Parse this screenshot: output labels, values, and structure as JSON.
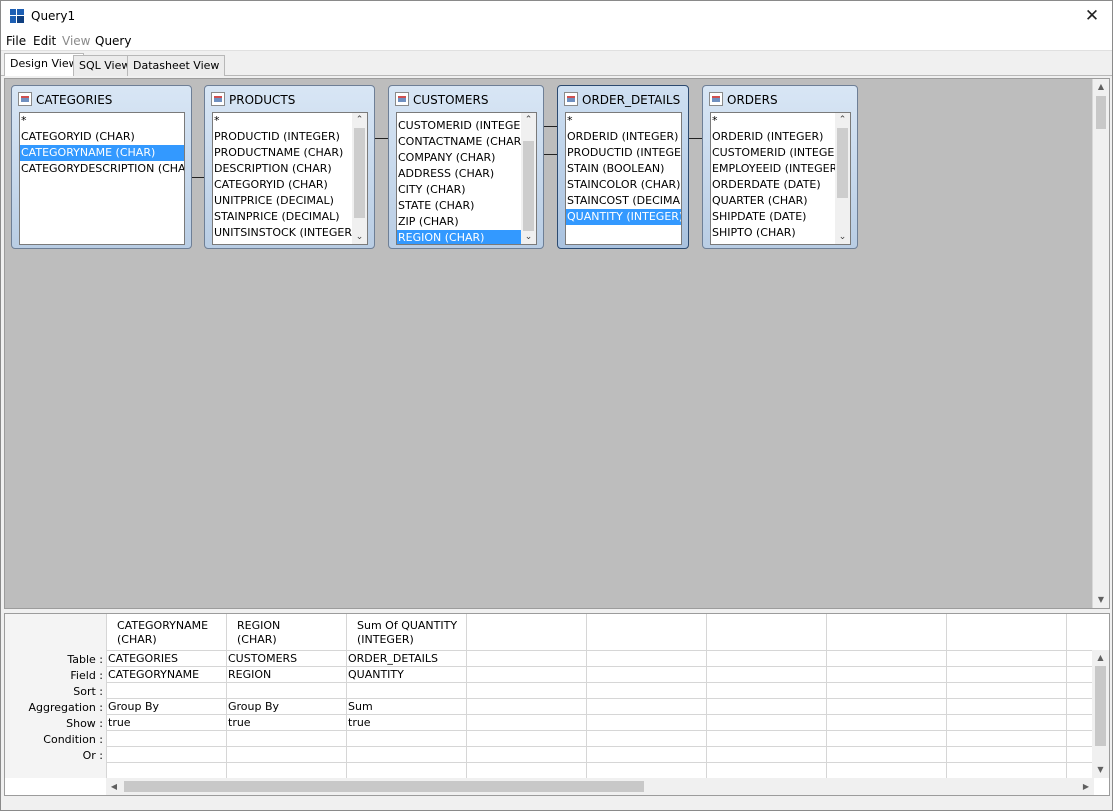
{
  "window": {
    "title": "Query1",
    "close_glyph": "✕"
  },
  "menu": {
    "file": "File",
    "edit": "Edit",
    "view": "View",
    "query": "Query"
  },
  "tabs": {
    "design": "Design View",
    "sql": "SQL View",
    "datasheet": "Datasheet View"
  },
  "tables": [
    {
      "name": "CATEGORIES",
      "fields": [
        "*",
        "CATEGORYID (CHAR)",
        "CATEGORYNAME (CHAR)",
        "CATEGORYDESCRIPTION (CHAR)"
      ]
    },
    {
      "name": "PRODUCTS",
      "fields": [
        "*",
        "PRODUCTID (INTEGER)",
        "PRODUCTNAME (CHAR)",
        "DESCRIPTION (CHAR)",
        "CATEGORYID (CHAR)",
        "UNITPRICE (DECIMAL)",
        "STAINPRICE (DECIMAL)",
        "UNITSINSTOCK (INTEGER)"
      ]
    },
    {
      "name": "CUSTOMERS",
      "fields": [
        "CUSTOMERID (INTEGER)",
        "CONTACTNAME (CHAR)",
        "COMPANY (CHAR)",
        "ADDRESS (CHAR)",
        "CITY (CHAR)",
        "STATE (CHAR)",
        "ZIP (CHAR)",
        "REGION (CHAR)"
      ]
    },
    {
      "name": "ORDER_DETAILS",
      "fields": [
        "*",
        "ORDERID (INTEGER)",
        "PRODUCTID (INTEGER)",
        "STAIN (BOOLEAN)",
        "STAINCOLOR (CHAR)",
        "STAINCOST (DECIMAL)",
        "QUANTITY (INTEGER)"
      ]
    },
    {
      "name": "ORDERS",
      "fields": [
        "*",
        "ORDERID (INTEGER)",
        "CUSTOMERID (INTEGER)",
        "EMPLOYEEID (INTEGER)",
        "ORDERDATE (DATE)",
        "QUARTER (CHAR)",
        "SHIPDATE (DATE)",
        "SHIPTO (CHAR)"
      ]
    }
  ],
  "grid": {
    "row_labels": [
      "Table :",
      "Field :",
      "Sort :",
      "Aggregation :",
      "Show :",
      "Condition :",
      "Or :"
    ],
    "columns": [
      {
        "header_line1": "CATEGORYNAME",
        "header_line2": "(CHAR)",
        "table": "CATEGORIES",
        "field": "CATEGORYNAME",
        "sort": "",
        "aggregation": "Group By",
        "show": "true",
        "condition": "",
        "or": ""
      },
      {
        "header_line1": "REGION",
        "header_line2": "(CHAR)",
        "table": "CUSTOMERS",
        "field": "REGION",
        "sort": "",
        "aggregation": "Group By",
        "show": "true",
        "condition": "",
        "or": ""
      },
      {
        "header_line1": "Sum Of QUANTITY",
        "header_line2": "(INTEGER)",
        "table": "ORDER_DETAILS",
        "field": "QUANTITY",
        "sort": "",
        "aggregation": "Sum",
        "show": "true",
        "condition": "",
        "or": ""
      }
    ]
  },
  "icons": {
    "up": "▲",
    "down": "▼",
    "left": "◀",
    "right": "▶",
    "list_up": "⌃",
    "list_down": "⌄"
  },
  "colors": {
    "selection": "#3399ff",
    "canvas": "#bdbdbd"
  }
}
